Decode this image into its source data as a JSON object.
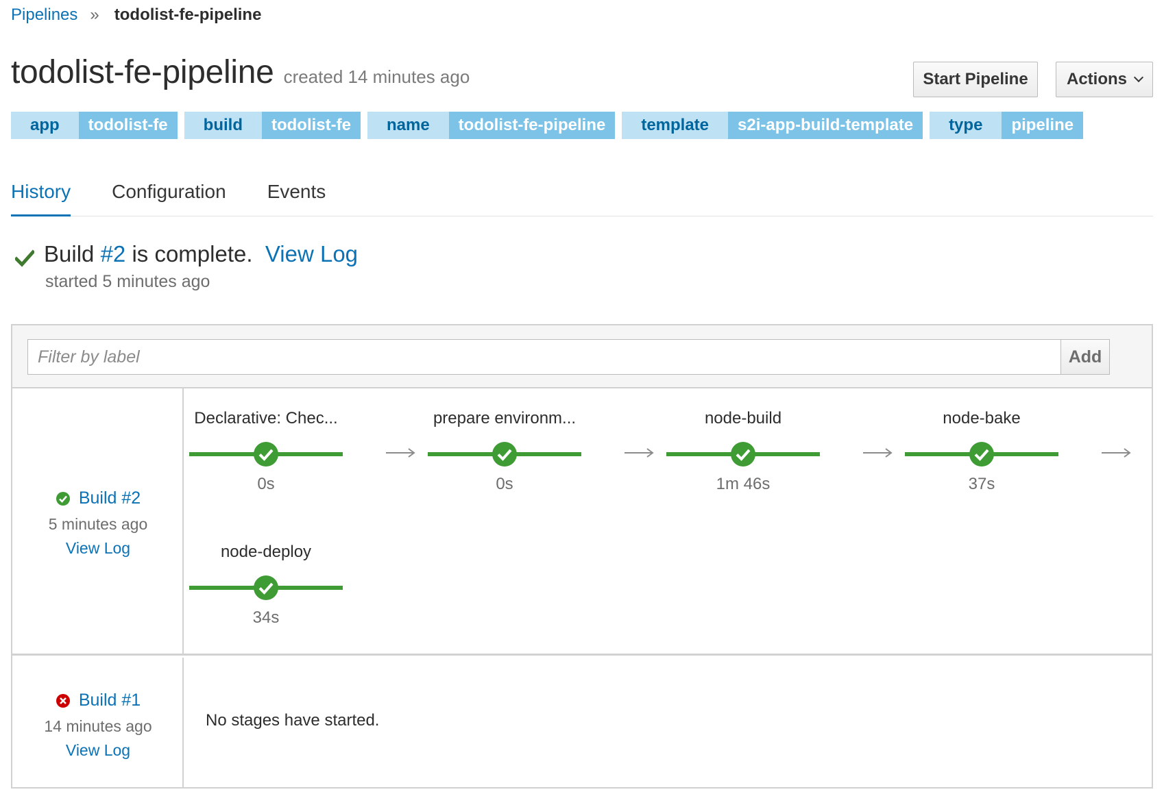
{
  "breadcrumb": {
    "parent": "Pipelines",
    "separator": "»",
    "current": "todolist-fe-pipeline"
  },
  "header": {
    "title": "todolist-fe-pipeline",
    "created": "created 14 minutes ago",
    "start_label": "Start Pipeline",
    "actions_label": "Actions"
  },
  "labels": [
    {
      "key": "app",
      "value": "todolist-fe"
    },
    {
      "key": "build",
      "value": "todolist-fe"
    },
    {
      "key": "name",
      "value": "todolist-fe-pipeline"
    },
    {
      "key": "template",
      "value": "s2i-app-build-template"
    },
    {
      "key": "type",
      "value": "pipeline"
    }
  ],
  "tabs": [
    {
      "label": "History",
      "active": true
    },
    {
      "label": "Configuration",
      "active": false
    },
    {
      "label": "Events",
      "active": false
    }
  ],
  "status": {
    "prefix": "Build ",
    "build_link": "#2",
    "suffix": " is complete.",
    "view_log": "View Log",
    "started": "started 5 minutes ago"
  },
  "filter": {
    "placeholder": "Filter by label",
    "add_label": "Add"
  },
  "builds": [
    {
      "title": "Build #2",
      "status": "success",
      "time": "5 minutes ago",
      "log_label": "View Log",
      "stages": [
        {
          "name": "Declarative: Chec...",
          "duration": "0s"
        },
        {
          "name": "prepare environm...",
          "duration": "0s"
        },
        {
          "name": "node-build",
          "duration": "1m 46s"
        },
        {
          "name": "node-bake",
          "duration": "37s"
        },
        {
          "name": "node-deploy",
          "duration": "34s"
        }
      ]
    },
    {
      "title": "Build #1",
      "status": "failed",
      "time": "14 minutes ago",
      "log_label": "View Log",
      "message": "No stages have started."
    }
  ],
  "colors": {
    "link": "#0b72b5",
    "success": "#3f9c35",
    "danger": "#cc0000",
    "label_key_bg": "#bee1f4",
    "label_value_bg": "#7dc3e8"
  }
}
